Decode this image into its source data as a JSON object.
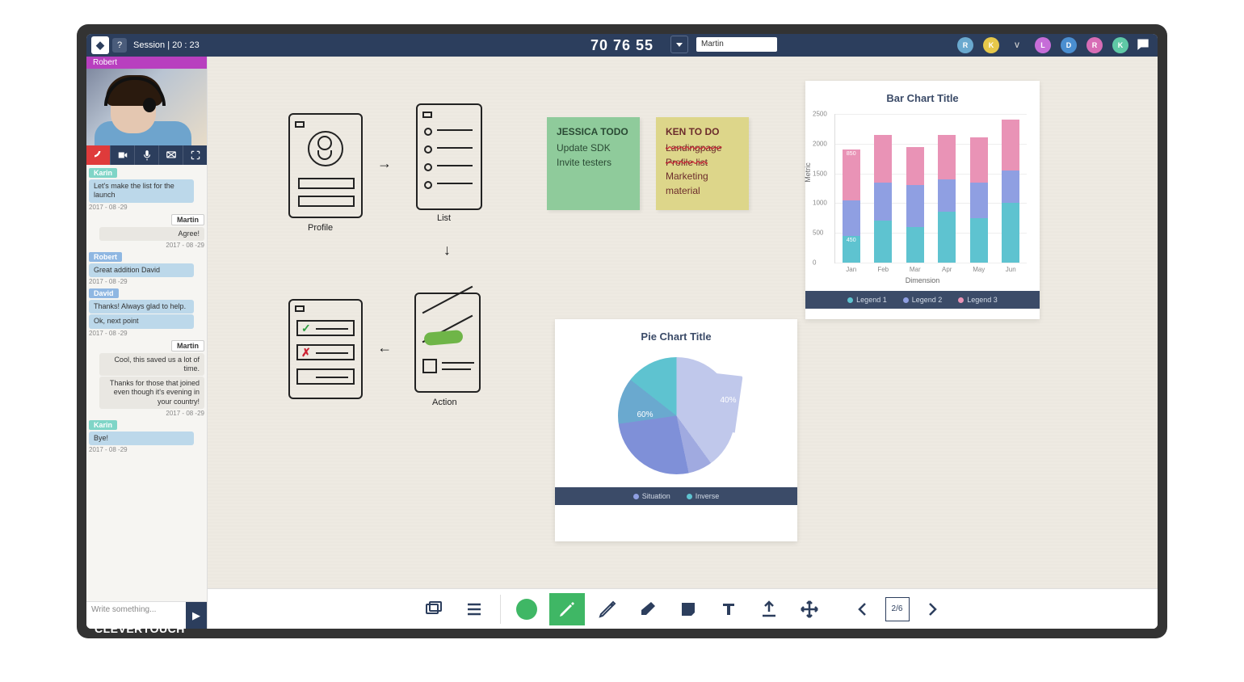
{
  "brand": "CLEVERTOUCH",
  "topbar": {
    "session_label": "Session | 20 : 23",
    "timer": "70 76 55",
    "search_value": "Martin",
    "participants": [
      {
        "initial": "R",
        "color": "#6aa9cf"
      },
      {
        "initial": "K",
        "color": "#e6c84a"
      },
      {
        "initial": "V",
        "color": "#ffffff00",
        "text": "#cccccc"
      },
      {
        "initial": "L",
        "color": "#c66dd8"
      },
      {
        "initial": "D",
        "color": "#4a8ed0"
      },
      {
        "initial": "R",
        "color": "#d86db6"
      },
      {
        "initial": "K",
        "color": "#5fc9a6"
      }
    ]
  },
  "video": {
    "name": "Robert"
  },
  "chat": {
    "messages": [
      {
        "name": "Karin",
        "name_color": "#7fd5c7",
        "texts": [
          "Let's make the list for the launch"
        ],
        "date": "2017 - 08 -29",
        "side": "left"
      },
      {
        "name": "Martin",
        "texts": [
          "Agree!"
        ],
        "date": "2017 - 08 -29",
        "side": "right"
      },
      {
        "name": "Robert",
        "name_color": "#8fb7e2",
        "texts": [
          "Great addition David"
        ],
        "date": "2017 - 08 -29",
        "side": "left"
      },
      {
        "name": "David",
        "name_color": "#8fb7e2",
        "texts": [
          "Thanks!\nAlways glad to help.",
          "Ok, next point"
        ],
        "date": "2017 - 08 -29",
        "side": "left"
      },
      {
        "name": "Martin",
        "texts": [
          "Cool, this saved us a lot of time.",
          "Thanks for those that joined even though it's evening in your country!"
        ],
        "date": "2017 - 08 -29",
        "side": "right"
      },
      {
        "name": "Karin",
        "name_color": "#7fd5c7",
        "texts": [
          "Bye!"
        ],
        "date": "2017 - 08 -29",
        "side": "left"
      }
    ],
    "input_placeholder": "Write something..."
  },
  "sketch_labels": {
    "profile": "Profile",
    "list": "List",
    "action": "Action"
  },
  "sticky1": {
    "title": "JESSICA TODO",
    "l1": "Update SDK",
    "l2": "Invite testers"
  },
  "sticky2": {
    "title": "KEN TO DO",
    "l1": "Landingpage",
    "l2": "Profile list",
    "l3": "Marketing material"
  },
  "toolbar": {
    "page": "2/6"
  },
  "chart_data": [
    {
      "type": "bar",
      "title": "Bar Chart Title",
      "xlabel": "Dimension",
      "ylabel": "Metric",
      "ylim": [
        0,
        2500
      ],
      "yticks": [
        0,
        500,
        1000,
        1500,
        2000,
        2500
      ],
      "categories": [
        "Jan",
        "Feb",
        "Mar",
        "Apr",
        "May",
        "Jun"
      ],
      "series": [
        {
          "name": "Legend 1",
          "color": "#5ec3d0",
          "values": [
            450,
            700,
            600,
            850,
            750,
            1000
          ]
        },
        {
          "name": "Legend 2",
          "color": "#8f9fe2",
          "values": [
            600,
            650,
            700,
            550,
            600,
            550
          ]
        },
        {
          "name": "Legend 3",
          "color": "#e993b6",
          "values": [
            850,
            800,
            650,
            750,
            750,
            850
          ]
        }
      ],
      "stack_labels": [
        {
          "category": "Jan",
          "series": 0,
          "text": "450"
        },
        {
          "category": "Jan",
          "series": 2,
          "text": "850"
        }
      ]
    },
    {
      "type": "pie",
      "title": "Pie Chart Title",
      "series": [
        {
          "name": "Situation",
          "color": "#8f9fe2"
        },
        {
          "name": "Inverse",
          "color": "#5ec3d0"
        }
      ],
      "values": [
        60,
        40
      ],
      "labels": [
        "60%",
        "40%"
      ]
    }
  ]
}
